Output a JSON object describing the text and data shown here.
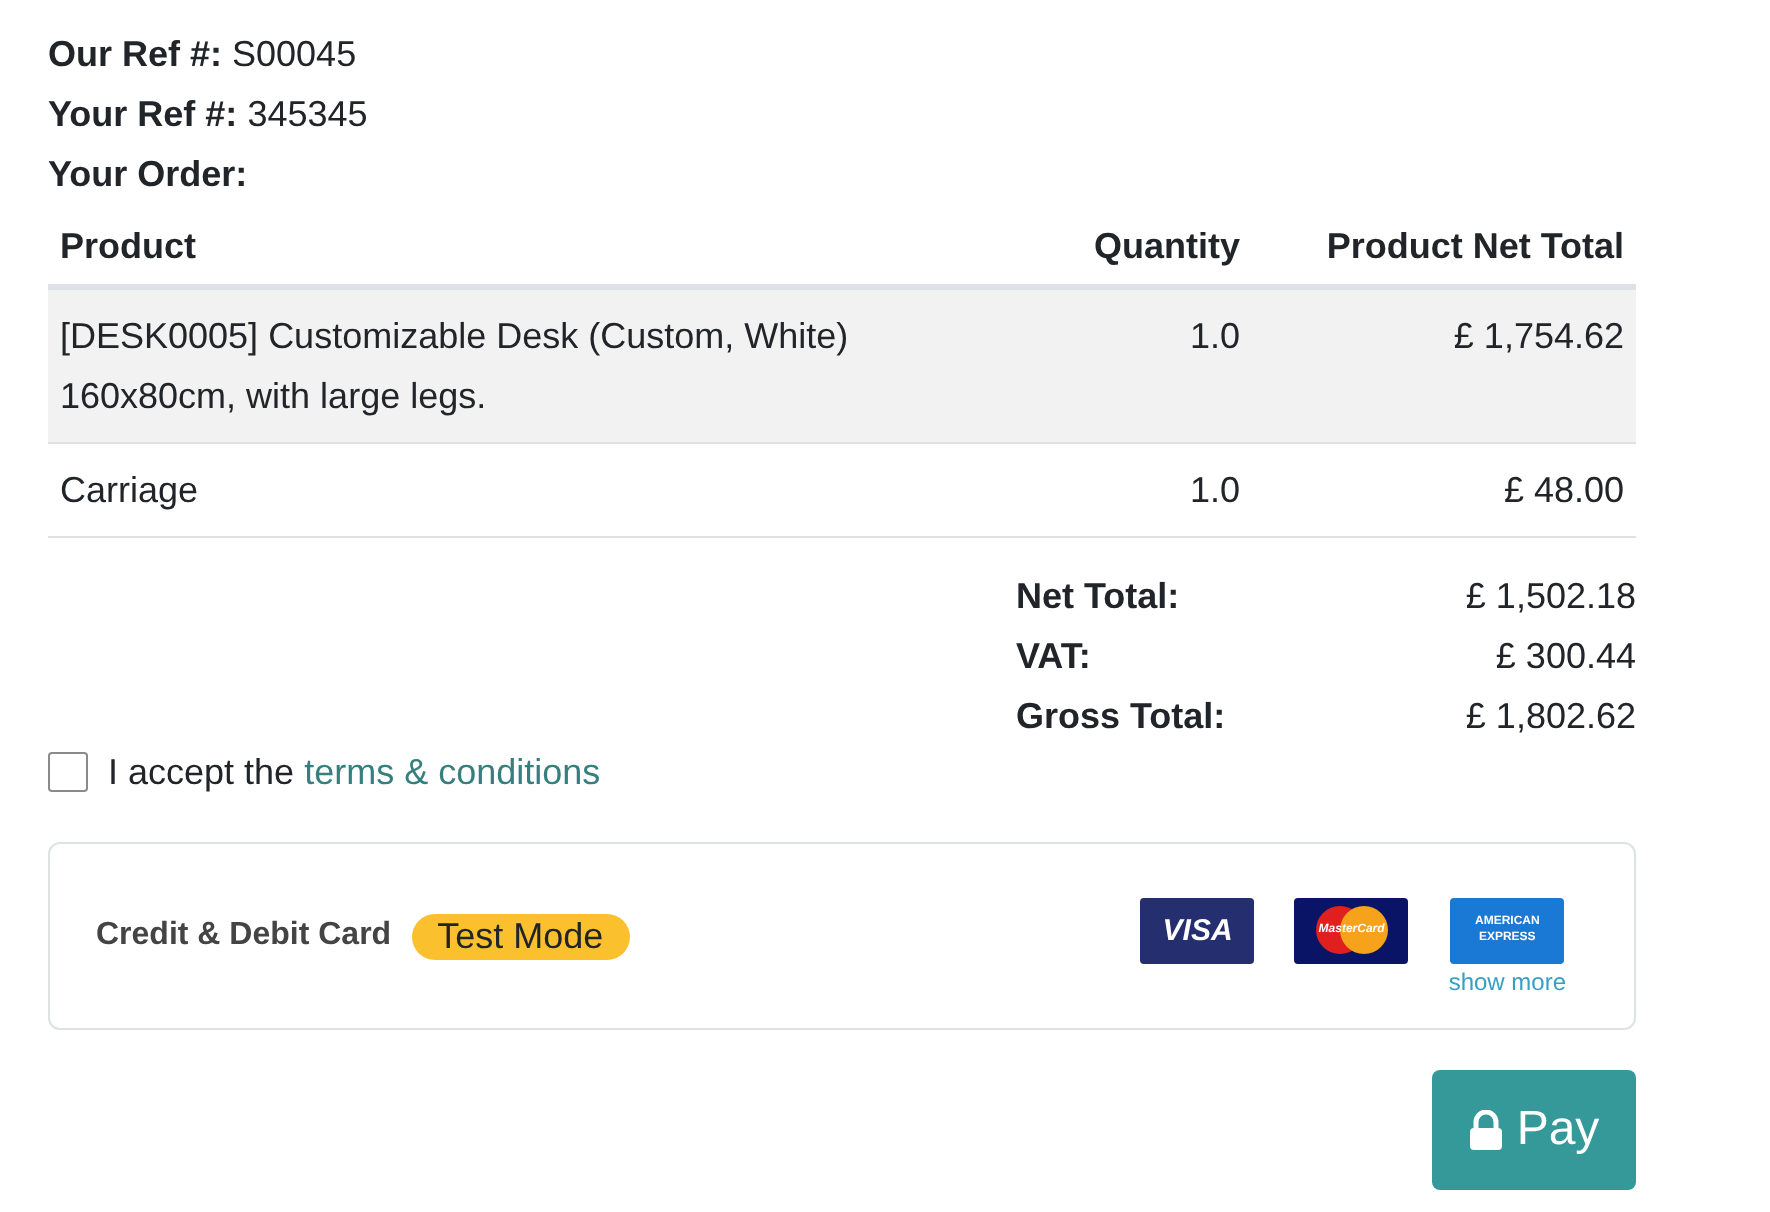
{
  "refs": [
    {
      "label": "Our Ref #:",
      "value": "S00045"
    },
    {
      "label": "Your Ref #:",
      "value": "345345"
    }
  ],
  "order_heading": "Your Order:",
  "table": {
    "columns": [
      "Product",
      "Quantity",
      "Product Net Total"
    ],
    "rows": [
      {
        "cells": [
          "[DESK0005] Customizable Desk (Custom, White) 160x80cm, with large legs.",
          "1.0",
          "£ 1,754.62"
        ],
        "selected": true
      },
      {
        "cells": [
          "Carriage",
          "1.0",
          "£ 48.00"
        ],
        "selected": false
      }
    ]
  },
  "totals": [
    {
      "label": "Net Total:",
      "value": "£ 1,502.18"
    },
    {
      "label": "VAT:",
      "value": "£ 300.44"
    },
    {
      "label": "Gross Total:",
      "value": "£ 1,802.62"
    }
  ],
  "terms": {
    "checked": false,
    "text": "I accept the ",
    "link": "terms & conditions"
  },
  "payment": {
    "title": "Credit & Debit Card",
    "badge": "Test Mode",
    "logos": [
      {
        "kind": "visa",
        "text": "VISA"
      },
      {
        "kind": "mastercard",
        "text": "MasterCard"
      },
      {
        "kind": "amex",
        "text": "AMERICAN EXPRESS"
      }
    ],
    "show_more": "show more"
  },
  "pay_button": "Pay"
}
